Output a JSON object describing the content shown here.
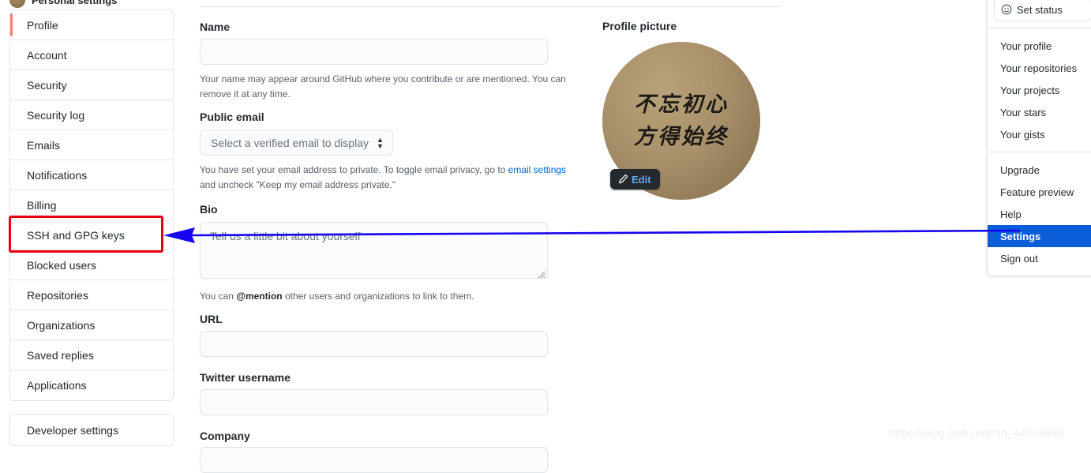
{
  "header": {
    "title": "Personal settings",
    "avatar_icon": "user-avatar-icon"
  },
  "sidebar": {
    "primary_items": [
      {
        "label": "Profile",
        "active": true
      },
      {
        "label": "Account",
        "active": false
      },
      {
        "label": "Security",
        "active": false
      },
      {
        "label": "Security log",
        "active": false
      },
      {
        "label": "Emails",
        "active": false
      },
      {
        "label": "Notifications",
        "active": false
      },
      {
        "label": "Billing",
        "active": false
      },
      {
        "label": "SSH and GPG keys",
        "active": false
      },
      {
        "label": "Blocked users",
        "active": false
      },
      {
        "label": "Repositories",
        "active": false
      },
      {
        "label": "Organizations",
        "active": false
      },
      {
        "label": "Saved replies",
        "active": false
      },
      {
        "label": "Applications",
        "active": false
      }
    ],
    "secondary_items": [
      {
        "label": "Developer settings"
      }
    ],
    "active_accent_color": "#f9826c"
  },
  "form": {
    "name": {
      "label": "Name",
      "value": "",
      "placeholder": "",
      "help": "Your name may appear around GitHub where you contribute or are mentioned. You can remove it at any time."
    },
    "public_email": {
      "label": "Public email",
      "selected_option": "Select a verified email to display",
      "help_before_link": "You have set your email address to private. To toggle email privacy, go to ",
      "help_link": "email settings",
      "help_after_link": " and uncheck \"Keep my email address private.\""
    },
    "bio": {
      "label": "Bio",
      "value": "",
      "placeholder": "Tell us a little bit about yourself",
      "help_before_mention": "You can ",
      "help_mention": "@mention",
      "help_after_mention": " other users and organizations to link to them."
    },
    "url": {
      "label": "URL",
      "value": "",
      "placeholder": ""
    },
    "twitter": {
      "label": "Twitter username",
      "value": "",
      "placeholder": ""
    },
    "company": {
      "label": "Company",
      "value": "",
      "placeholder": ""
    }
  },
  "profile_picture": {
    "label": "Profile picture",
    "avatar_line1": "不忘初心",
    "avatar_line2": "方得始终",
    "edit_label": "Edit",
    "edit_icon": "pencil-icon",
    "edit_text_color": "#58a6ff",
    "edit_background_color": "#24292e"
  },
  "account_dropdown": {
    "status_button": {
      "label": "Set status",
      "icon": "smiley-icon"
    },
    "section_one": [
      {
        "label": "Your profile"
      },
      {
        "label": "Your repositories"
      },
      {
        "label": "Your projects"
      },
      {
        "label": "Your stars"
      },
      {
        "label": "Your gists"
      }
    ],
    "section_two": [
      {
        "label": "Upgrade",
        "selected": false
      },
      {
        "label": "Feature preview",
        "selected": false
      },
      {
        "label": "Help",
        "selected": false
      },
      {
        "label": "Settings",
        "selected": true
      },
      {
        "label": "Sign out",
        "selected": false
      }
    ],
    "highlight_color": "#0b5ed7"
  },
  "annotations": {
    "highlight_box_target": "SSH and GPG keys",
    "highlight_box_color": "#e8000d",
    "arrow_color": "#1505f0",
    "arrow_from": "Settings",
    "arrow_to": "SSH and GPG keys"
  },
  "watermark": {
    "text": "https://blog.csdn.net/qq_44349849"
  }
}
